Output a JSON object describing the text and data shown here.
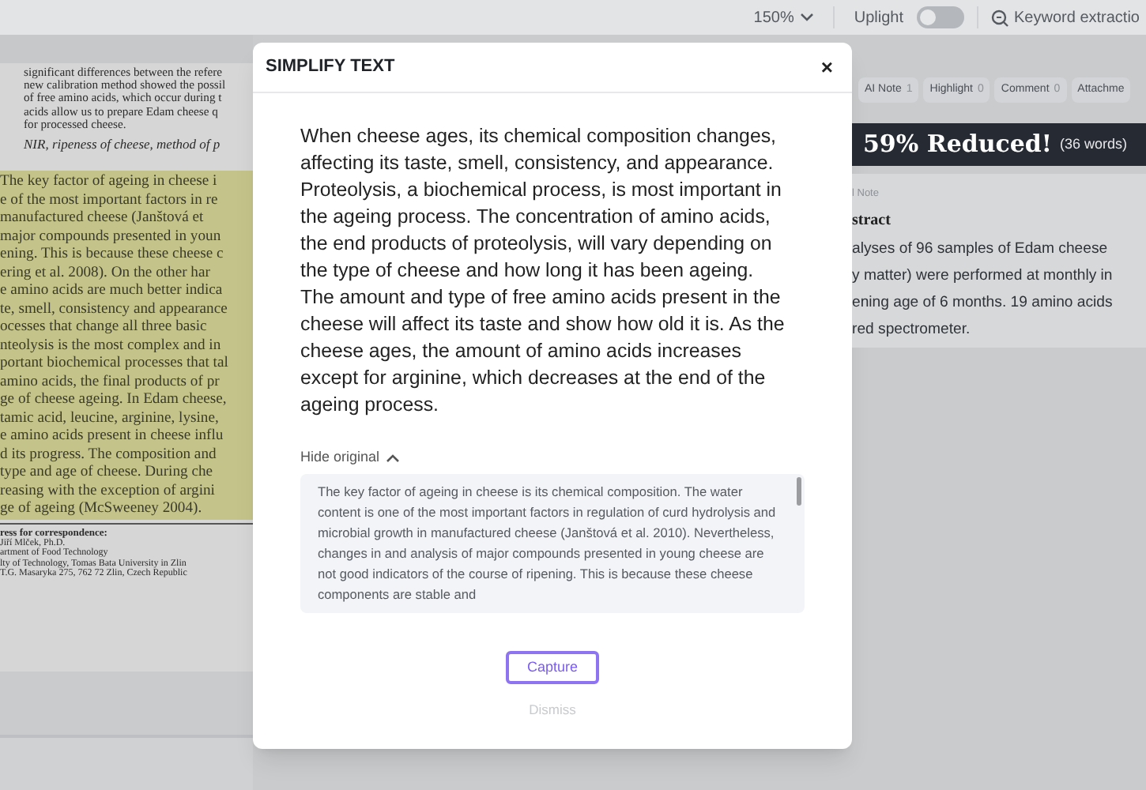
{
  "toolbar": {
    "zoom": "150%",
    "uplight": {
      "label": "Uplight",
      "on": false
    },
    "keyword_button": "Keyword extractio"
  },
  "pdf": {
    "abstract_lines": [
      "significant differences between the refere",
      "new calibration method showed the possil",
      "of free amino acids, which occur during t",
      "acids allow us to prepare Edam cheese q",
      "for processed cheese."
    ],
    "keywords": "NIR, ripeness of cheese, method of p",
    "highlighted_lines": [
      "The key factor of ageing in cheese i",
      "e of the most important factors in re",
      "manufactured cheese (Janštová et",
      "major compounds presented in youn",
      "ening. This is because these cheese c",
      "ering et al. 2008). On the other har",
      "e amino acids are much better indica",
      "te, smell, consistency and appearance",
      "ocesses that change all three basic",
      "nteolysis is the most complex and in",
      "portant biochemical processes that tal",
      "amino acids, the final products of pr",
      "ge of cheese ageing. In Edam cheese,",
      "tamic acid, leucine, arginine, lysine,",
      "e amino acids present in cheese influ",
      "d its progress. The composition and",
      "type and age of cheese. During che",
      "reasing with the exception of argini",
      "ge of ageing (McSweeney 2004)."
    ],
    "correspondence_heading": "ress for correspondence:",
    "correspondence_lines": [
      "Jiří Mlček, Ph.D.",
      "artment of Food Technology",
      "lty of Technology, Tomas Bata University in Zlin",
      "T.G. Masaryka 275, 762 72 Zlin, Czech Republic"
    ]
  },
  "dialog": {
    "title": "SIMPLIFY TEXT",
    "close": "×",
    "simplified": "When cheese ages, its chemical composition changes, affecting its taste, smell, consistency, and appearance. Proteolysis, a biochemical process, is most important in the ageing process. The concentration of amino acids, the end products of proteolysis, will vary depending on the type of cheese and how long it has been ageing. The amount and type of free amino acids present in the cheese will affect its taste and show how old it is. As the cheese ages, the amount of amino acids increases except for arginine, which decreases at the end of the ageing process.",
    "toggle_original": {
      "label": "Hide original",
      "expanded": true
    },
    "original": "The key factor of ageing in cheese is its chemical composition. The water content is one of the most important factors in regulation of curd hydrolysis and microbial growth in manufactured cheese (Janštová et al. 2010). Nevertheless, changes in and analysis of major compounds presented in young cheese are not good indicators of the course of ripening. This is because these cheese components are stable and",
    "primary_button": "Capture",
    "secondary_button": "Dismiss"
  },
  "side_panel": {
    "tabs": [
      {
        "label": "AI Note",
        "count": "1"
      },
      {
        "label": "Highlight",
        "count": "0"
      },
      {
        "label": "Comment",
        "count": "0"
      },
      {
        "label": "Attachme"
      }
    ],
    "banner": {
      "headline": "59% Reduced!",
      "words": "(36 words)"
    },
    "note": {
      "label": "l Note",
      "heading": "stract",
      "lines": [
        "alyses of 96 samples of Edam cheese",
        "y matter) were performed at monthly in",
        "ening age of 6 months. 19 amino acids",
        "red spectrometer."
      ]
    }
  }
}
